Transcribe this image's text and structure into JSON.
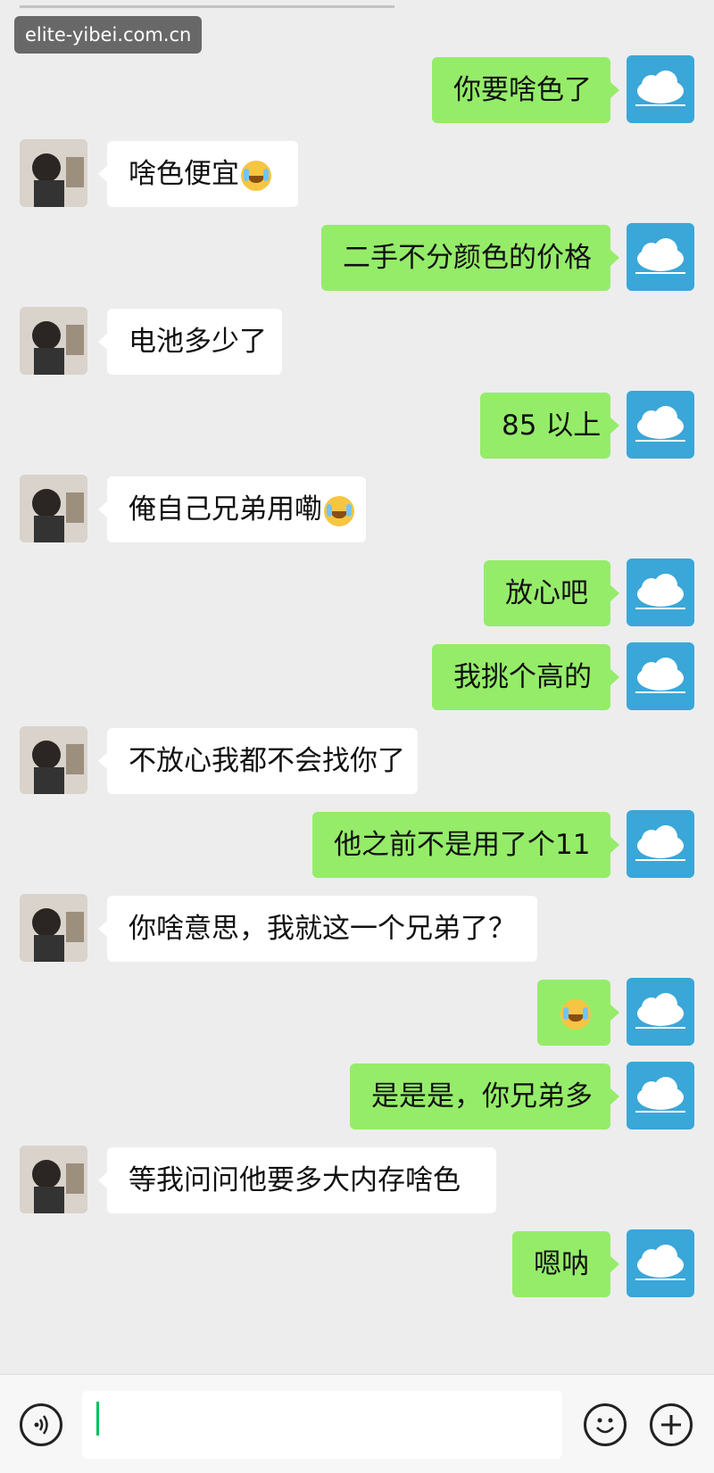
{
  "watermark": "elite-yibei.com.cn",
  "messages": [
    {
      "side": "right",
      "text": "你要啥色了",
      "emoji": false
    },
    {
      "side": "left",
      "text": "啥色便宜",
      "emoji": true
    },
    {
      "side": "right",
      "text": "二手不分颜色的价格",
      "emoji": false
    },
    {
      "side": "left",
      "text": "电池多少了",
      "emoji": false
    },
    {
      "side": "right",
      "text": "85 以上",
      "emoji": false
    },
    {
      "side": "left",
      "text": "俺自己兄弟用嘞",
      "emoji": true
    },
    {
      "side": "right",
      "text": "放心吧",
      "emoji": false
    },
    {
      "side": "right",
      "text": "我挑个高的",
      "emoji": false
    },
    {
      "side": "left",
      "text": "不放心我都不会找你了",
      "emoji": false
    },
    {
      "side": "right",
      "text": "他之前不是用了个11",
      "emoji": false
    },
    {
      "side": "left",
      "text": "你啥意思，我就这一个兄弟了？",
      "emoji": false
    },
    {
      "side": "right",
      "text": "",
      "emoji": true
    },
    {
      "side": "right",
      "text": "是是是，你兄弟多",
      "emoji": false
    },
    {
      "side": "left",
      "text": "等我问问他要多大内存啥色",
      "emoji": false
    },
    {
      "side": "right",
      "text": "嗯呐",
      "emoji": false
    }
  ],
  "icons": {
    "voice": "voice-icon",
    "emoji": "emoji-icon",
    "add": "add-icon",
    "emoji_in_bubble": "laughing-crying-emoji"
  },
  "colors": {
    "background": "#ededed",
    "self_bubble": "#95ec69",
    "other_bubble": "#ffffff",
    "self_avatar": "#3aa7d8",
    "caret": "#07c160"
  }
}
